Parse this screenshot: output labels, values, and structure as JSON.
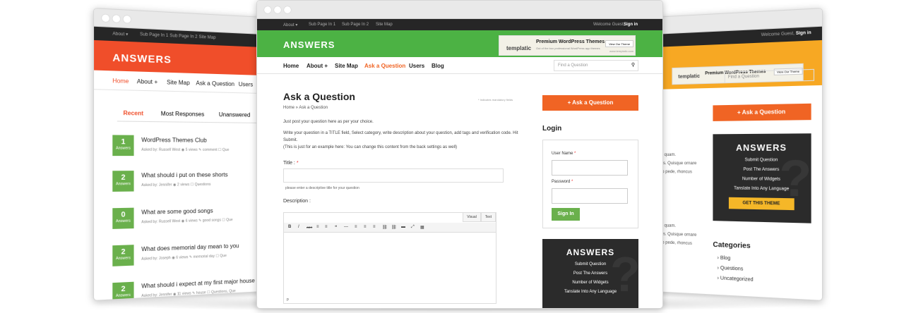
{
  "left": {
    "top_links": [
      "About ▾",
      "Sub Page In 1",
      "Sub Page In 2",
      "Site Map"
    ],
    "brand": "ANSWERS",
    "nav": [
      "Home",
      "About +",
      "Site Map",
      "Ask a Question",
      "Users"
    ],
    "tabs": [
      "Recent",
      "Most Responses",
      "Unanswered"
    ],
    "questions": [
      {
        "count": "1",
        "label": "Answers",
        "title": "WordPress Themes Club",
        "meta": "Asked by: Russell West   ◉ 5 views   ✎ comment   ☐ Que"
      },
      {
        "count": "2",
        "label": "Answers",
        "title": "What should i put on these shorts",
        "meta": "Asked by: Jennifer   ◉ 2 views   ☐ Questions"
      },
      {
        "count": "0",
        "label": "Answers",
        "title": "What are some good songs",
        "meta": "Asked by: Russell West   ◉ 6 views   ✎ good songs   ☐ Que"
      },
      {
        "count": "2",
        "label": "Answers",
        "title": "What does memorial day mean to you",
        "meta": "Asked by: Joseph   ◉ 6 views   ✎ memorial day   ☐ Que"
      },
      {
        "count": "2",
        "label": "Answers",
        "title": "What should i expect at my first major house pa",
        "meta": "Asked by: Jennifer   ◉ 11 views   ✎ house   ☐ Questions, Que"
      }
    ]
  },
  "center": {
    "top_links": [
      "About ▾",
      "Sub Page In 1",
      "Sub Page In 2",
      "Site Map"
    ],
    "welcome": "Welcome Guest,",
    "signin": "Sign in",
    "brand": "ANSWERS",
    "ad": {
      "logo": "templatic",
      "title": "Premium WordPress Themes",
      "sub": "Out of the box professional WordPress app themes",
      "button": "View Our Theme",
      "url": "www.templatic.com"
    },
    "nav": [
      "Home",
      "About +",
      "Site Map",
      "Ask a Question",
      "Users",
      "Blog"
    ],
    "search_placeholder": "Find a Question",
    "heading": "Ask a Question",
    "mandatory": "* Indicates mandatory fields",
    "breadcrumb": "Home » Ask a Question",
    "intro1": "Just post your question here as per your choice.",
    "intro2": "Write your question in a TITLE field, Select category, write description about your question, add tags and verification code. Hit Submit.",
    "intro3": "(This is just for an example here: You can change this content from the back settings as well)",
    "title_label": "Title :",
    "title_hint": "please enter a descriptive title for your question",
    "desc_label": "Description :",
    "editor_tabs": [
      "Visual",
      "Text"
    ],
    "editor_tools": [
      "B",
      "I",
      "ABC",
      "≡",
      "≡",
      "❝",
      "—",
      "≡",
      "≡",
      "≡",
      "⛓",
      "⛓",
      "▬",
      "⤢",
      "▦"
    ],
    "editor_footer": "p",
    "ask_button": "+ Ask a Question",
    "login_title": "Login",
    "username_label": "User Name",
    "password_label": "Password",
    "signin_button": "Sign In",
    "box_title": "ANSWERS",
    "box_items": [
      "Submit Question",
      "Post The Answers",
      "Number of Widgets",
      "Tanslate Into Any Language"
    ]
  },
  "right": {
    "welcome": "Welcome Guest,",
    "signin": "Sign in",
    "ad_logo": "templatic",
    "ad_title": "Premium WordPress Themes",
    "ad_button": "View Our Theme",
    "search_placeholder": "Find a Question",
    "ask_button": "+ Ask a Question",
    "box_title": "ANSWERS",
    "box_items": [
      "Submit Question",
      "Post The Answers",
      "Number of Widgets",
      "Tanslate Into Any Language"
    ],
    "box_button": "GET THIS THEME",
    "snippets": [
      "e quam.",
      "us. Quisque ornare",
      "to pede, rhoncus",
      "e quam.",
      "us. Quisque ornare",
      "to pede, rhoncus"
    ],
    "categories_title": "Categories",
    "categories": [
      "Blog",
      "Questions",
      "Uncategorized"
    ]
  },
  "colors": {
    "left_accent": "#f04e2a",
    "center_accent": "#4cb244",
    "right_accent": "#f7a823",
    "cta": "#f06424"
  }
}
